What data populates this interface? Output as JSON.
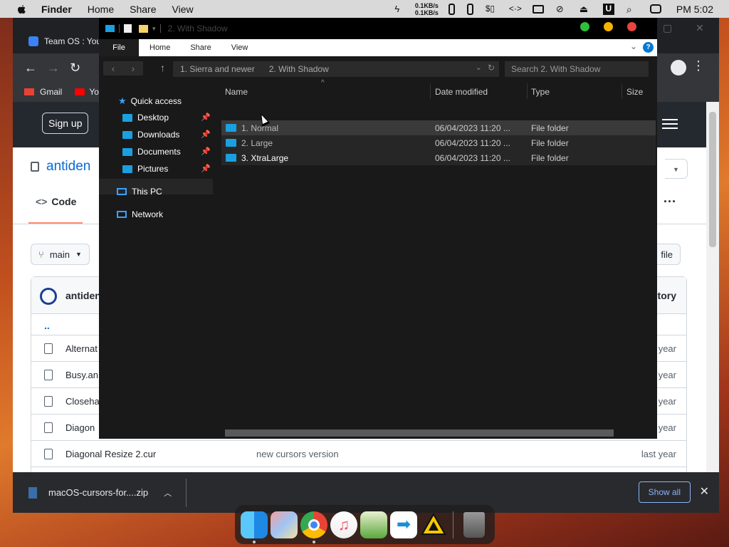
{
  "menubar": {
    "items": [
      "Finder",
      "Home",
      "Share",
      "View"
    ],
    "net_up": "0.1KB/s",
    "net_down": "0.1KB/s",
    "clock": "PM 5:02"
  },
  "chrome": {
    "tab_title": "Team OS : You",
    "bookmarks": [
      "Gmail",
      "Yo"
    ],
    "github": {
      "signup": "Sign up",
      "repo": "antiden",
      "code_tab": "Code",
      "branch": "main",
      "addfile": "file",
      "owner": "antiden",
      "history": "tory",
      "up": "..",
      "rows": [
        {
          "name": "Alternat",
          "msg": "",
          "age": "year"
        },
        {
          "name": "Busy.an",
          "msg": "",
          "age": "year"
        },
        {
          "name": "Closeha",
          "msg": "",
          "age": "year"
        },
        {
          "name": "Diagon",
          "msg": "",
          "age": "year"
        },
        {
          "name": "Diagonal Resize 2.cur",
          "msg": "new cursors version",
          "age": "last year"
        }
      ]
    },
    "download": {
      "file": "macOS-cursors-for....zip",
      "show_all": "Show all"
    }
  },
  "explorer": {
    "title": "2. With Shadow",
    "ribbon": [
      "File",
      "Home",
      "Share",
      "View"
    ],
    "path": [
      "1. Sierra and newer",
      "2. With Shadow"
    ],
    "search_placeholder": "Search 2. With Shadow",
    "nav": {
      "quick_access": "Quick access",
      "desktop": "Desktop",
      "downloads": "Downloads",
      "documents": "Documents",
      "pictures": "Pictures",
      "this_pc": "This PC",
      "network": "Network"
    },
    "columns": [
      "Name",
      "Date modified",
      "Type",
      "Size"
    ],
    "rows": [
      {
        "name": "1. Normal",
        "date": "06/04/2023 11:20 ...",
        "type": "File folder"
      },
      {
        "name": "2. Large",
        "date": "06/04/2023 11:20 ...",
        "type": "File folder"
      },
      {
        "name": "3. XtraLarge",
        "date": "06/04/2023 11:20 ...",
        "type": "File folder"
      }
    ]
  },
  "colors": {
    "traffic_green": "#2fbf3a",
    "traffic_yellow": "#f4b400",
    "traffic_red": "#e8453c",
    "folder_blue": "#1aa0e0",
    "selected_row": "#3a3a3a"
  },
  "dock": [
    "finder-icon",
    "launchpad-icon",
    "chrome-icon",
    "music-icon",
    "preview-icon",
    "migration-icon",
    "cursor-app-icon",
    "trash-icon"
  ]
}
